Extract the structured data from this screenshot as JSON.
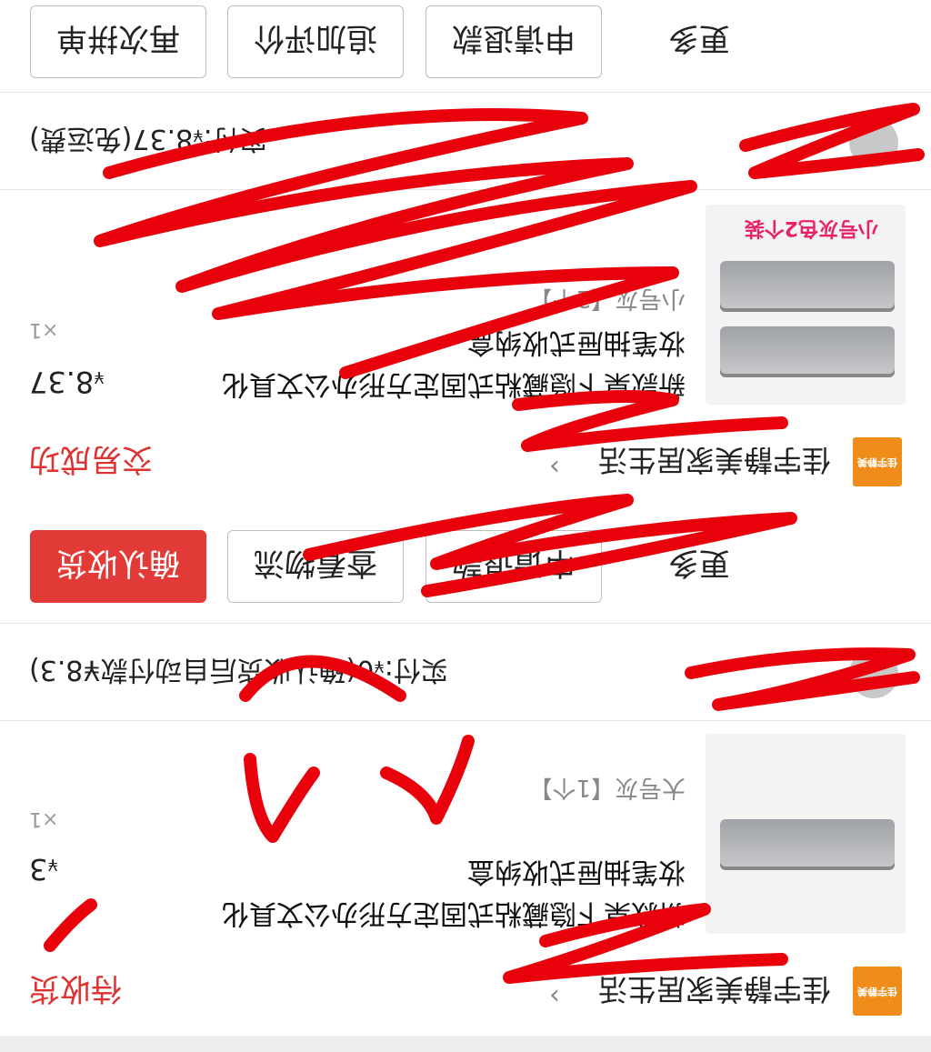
{
  "orders": [
    {
      "shop_name": "佳宇静美家居生活",
      "shop_logo_text": "佳宇静美",
      "status": "待收货",
      "product": {
        "title": "新款桌下隐藏粘式固定方形办公文具化妆笔抽屉式收纳盒",
        "sku": "大号灰【1个】",
        "price_prefix": "¥",
        "price": "3",
        "qty": "×1"
      },
      "payment": {
        "prefix": "实付:",
        "currency": "¥",
        "amount": "0",
        "note": "(确认收货后自动付款¥8.3)"
      },
      "buttons": {
        "more": "更多",
        "refund": "申请退款",
        "logistics": "查看物流",
        "confirm": "确认收货"
      }
    },
    {
      "shop_name": "佳宇静美家居生活",
      "shop_logo_text": "佳宇静美",
      "status": "交易成功",
      "product": {
        "title": "新款桌下隐藏粘式固定方形办公文具化妆笔抽屉式收纳盒",
        "sku": "小号灰【2个】",
        "promo": "小号灰色2个装",
        "price_prefix": "¥",
        "price": "8.37",
        "qty": "×1"
      },
      "payment": {
        "prefix": "实付:",
        "currency": "¥",
        "amount": "8.37",
        "note": "(免运费)"
      },
      "buttons": {
        "more": "更多",
        "refund": "申请退款",
        "review": "追加评价",
        "rebuy": "再次拼单"
      }
    }
  ],
  "colors": {
    "accent_red": "#e23a36",
    "status_red": "#e03131",
    "logo_orange": "#f08c1a",
    "scribble_red": "#e8000b"
  }
}
